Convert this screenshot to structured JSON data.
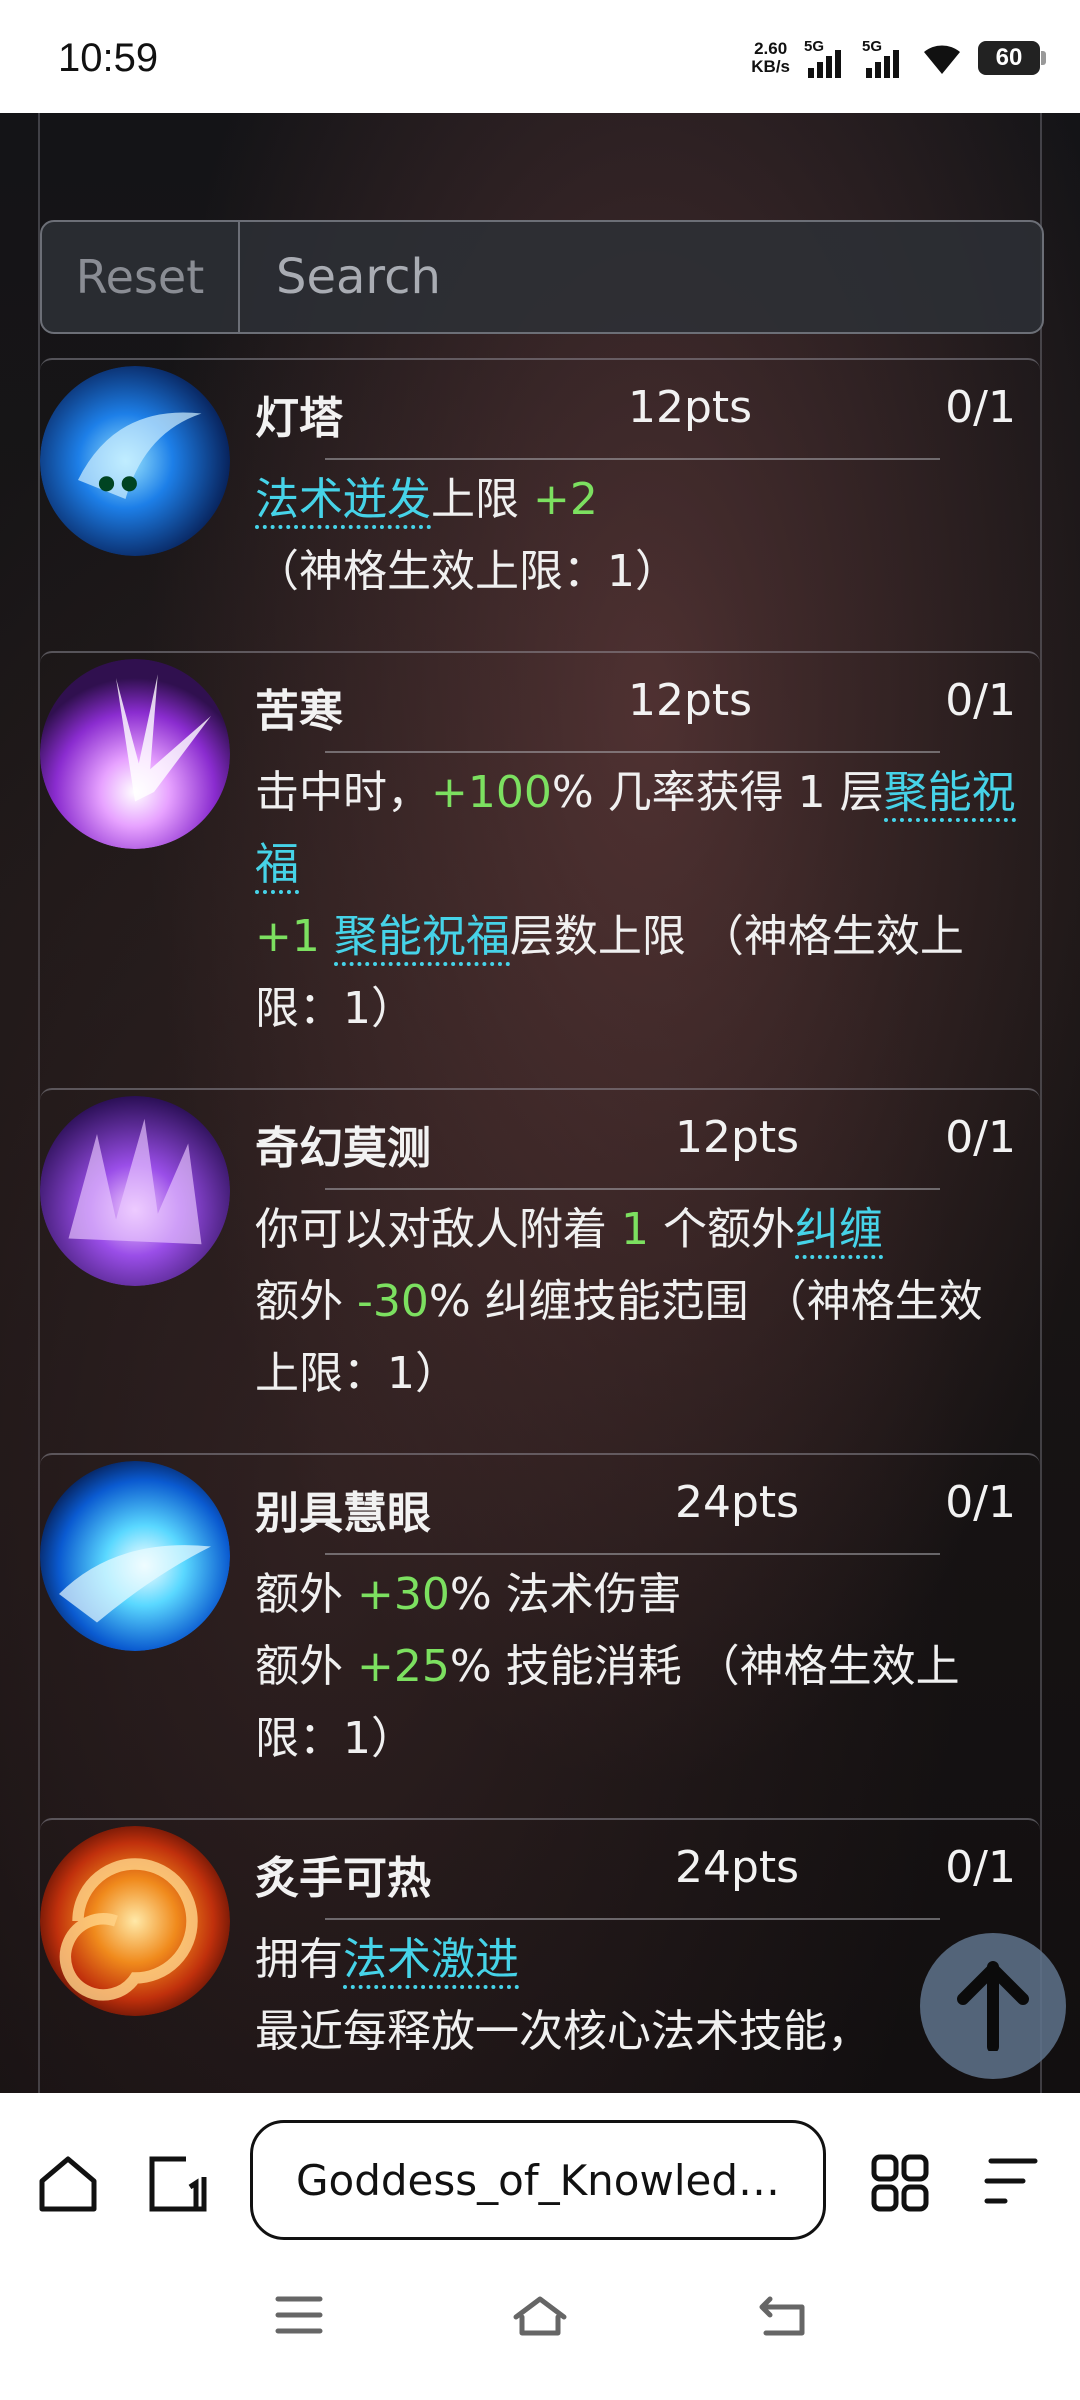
{
  "status_bar": {
    "time": "10:59",
    "net_speed_value": "2.60",
    "net_speed_unit": "KB/s",
    "signal1_label": "5G",
    "signal2_label": "5G",
    "battery": "60"
  },
  "toolbar": {
    "reset_label": "Reset",
    "search_placeholder": "Search"
  },
  "talents": [
    {
      "name": "灯塔",
      "pts": "12pts",
      "level": "0/1",
      "lines": [
        [
          {
            "t": "法术迸发",
            "c": "k"
          },
          {
            "t": "上限 "
          },
          {
            "t": "+2",
            "c": "g"
          },
          {
            "t": " （神格生效上限：1）"
          }
        ]
      ]
    },
    {
      "name": "苦寒",
      "pts": "12pts",
      "level": "0/1",
      "lines": [
        [
          {
            "t": "击中时，"
          },
          {
            "t": "+100",
            "c": "g"
          },
          {
            "t": "% 几率获得 1 层"
          },
          {
            "t": "聚能祝福",
            "c": "k"
          }
        ],
        [
          {
            "t": "+1",
            "c": "g"
          },
          {
            "t": " "
          },
          {
            "t": "聚能祝福",
            "c": "k"
          },
          {
            "t": "层数上限 （神格生效上限：1）"
          }
        ]
      ]
    },
    {
      "name": "奇幻莫测",
      "pts": "12pts",
      "level": "0/1",
      "lines": [
        [
          {
            "t": "你可以对敌人附着 "
          },
          {
            "t": "1",
            "c": "g"
          },
          {
            "t": " 个额外"
          },
          {
            "t": "纠缠",
            "c": "k"
          }
        ],
        [
          {
            "t": "额外 "
          },
          {
            "t": "-30",
            "c": "g"
          },
          {
            "t": "% 纠缠技能范围 （神格生效上限：1）"
          }
        ]
      ]
    },
    {
      "name": "别具慧眼",
      "pts": "24pts",
      "level": "0/1",
      "lines": [
        [
          {
            "t": "额外 "
          },
          {
            "t": "+30",
            "c": "g"
          },
          {
            "t": "% 法术伤害"
          }
        ],
        [
          {
            "t": "额外 "
          },
          {
            "t": "+25",
            "c": "g"
          },
          {
            "t": "% 技能消耗 （神格生效上限：1）"
          }
        ]
      ]
    },
    {
      "name": "炙手可热",
      "pts": "24pts",
      "level": "0/1",
      "lines": [
        [
          {
            "t": "拥有"
          },
          {
            "t": "法术激进",
            "c": "k"
          }
        ],
        [
          {
            "t": "最近每释放一次核心法术技能，"
          }
        ]
      ]
    }
  ],
  "browser": {
    "url": "Goddess_of_Knowled…"
  },
  "icons": {
    "home": "home-icon",
    "tabs": "tabs-icon",
    "grid": "apps-grid-icon",
    "menu": "menu-icon",
    "scroll_top": "arrow-up-icon",
    "sys_menu": "recent-apps-icon",
    "sys_home": "home-nav-icon",
    "sys_back": "back-icon"
  },
  "colors": {
    "green": "#7ce060",
    "keyword": "#46d3e8"
  }
}
